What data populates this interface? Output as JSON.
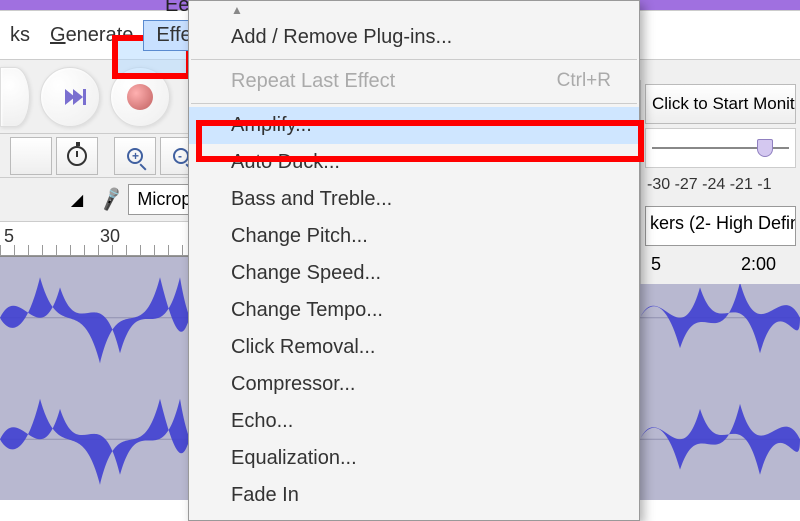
{
  "title": "Ee",
  "menubar": {
    "ks": "ks",
    "generate": "Generate",
    "effect": "Effect"
  },
  "right": {
    "monitor": "Click to Start Monito",
    "db_scale": "-30 -27 -24 -21 -1",
    "speakers": "kers (2- High Defin"
  },
  "ruler": {
    "left": {
      "t5": "5",
      "t30": "30"
    },
    "right": {
      "t5": "5",
      "t200": "2:00"
    }
  },
  "device": {
    "mic": "Microp"
  },
  "dropdown": {
    "add_remove": "Add / Remove Plug-ins...",
    "repeat": "Repeat Last Effect",
    "repeat_accel": "Ctrl+R",
    "amplify": "Amplify...",
    "auto_duck": "Auto Duck...",
    "bass": "Bass and Treble...",
    "pitch": "Change Pitch...",
    "speed": "Change Speed...",
    "tempo": "Change Tempo...",
    "click": "Click Removal...",
    "compressor": "Compressor...",
    "echo": "Echo...",
    "eq": "Equalization...",
    "fadein": "Fade In"
  }
}
